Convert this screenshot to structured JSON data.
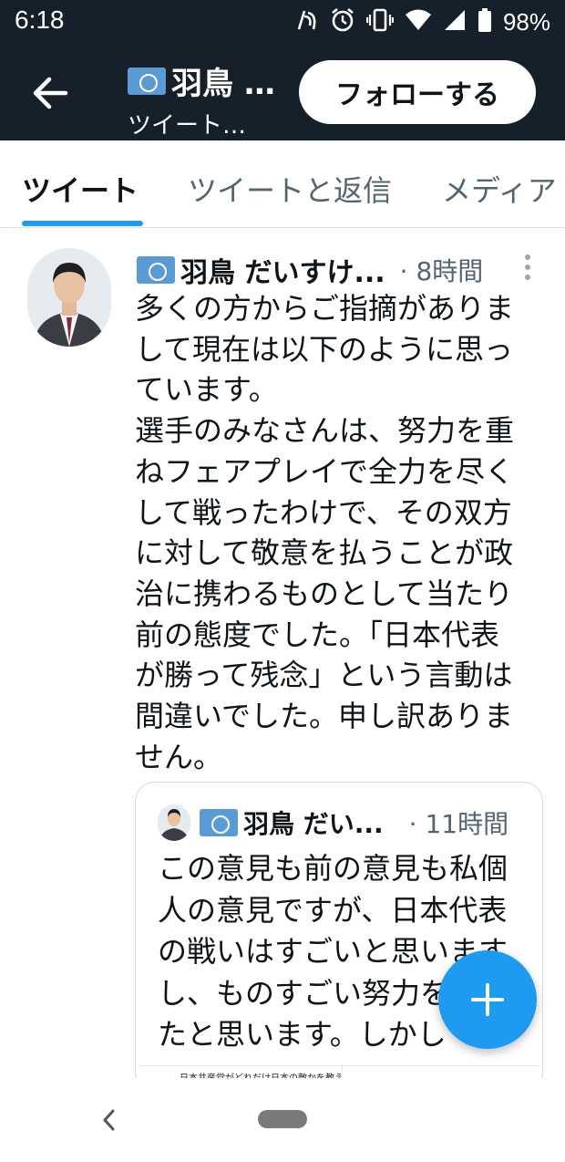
{
  "status_bar": {
    "time": "6:18",
    "battery": "98%",
    "icons": [
      "nfc-icon",
      "alarm-icon",
      "vibrate-icon",
      "wifi-icon",
      "signal-icon",
      "battery-icon"
    ]
  },
  "header": {
    "name": "羽鳥 …",
    "subtitle": "ツイート…",
    "follow_label": "フォローする",
    "back_icon": "arrow-left-icon"
  },
  "tabs": [
    {
      "label": "ツイート",
      "active": true
    },
    {
      "label": "ツイートと返信",
      "active": false
    },
    {
      "label": "メディア",
      "active": false
    }
  ],
  "tweet": {
    "name": "羽鳥 だいすけ...",
    "time": "· 8時間",
    "text": "多くの方からご指摘がありま\nして現在は以下のように思っ\nています。\n選手のみなさんは、努力を重\nねフェアプレイで全力を尽く\nして戦ったわけで、その双方\nに対して敬意を払うことが政\n治に携わるものとして当たり\n前の態度でした。「日本代表\nが勝って残念」という言動は\n間違いでした。申し訳ありま\nせん。"
  },
  "quoted_tweet": {
    "name": "羽鳥 だい...",
    "time": "· 11時間",
    "text": "この意見も前の意見も私個\n人の意見ですが、日本代表\nの戦いはすごいと思います\nし、ものすごい努力をされ\nたと思います。しかし",
    "media_caption": "日本共産党がどれだけ日本の敵かを教え"
  },
  "colors": {
    "header_bg": "#15202b",
    "accent": "#1d9bf0",
    "secondary_text": "#536471"
  }
}
